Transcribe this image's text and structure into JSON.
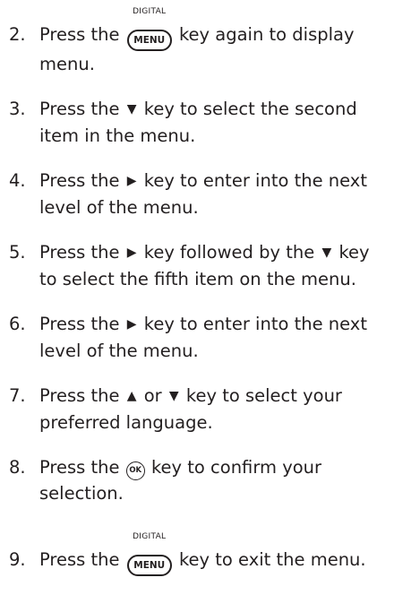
{
  "steps": [
    {
      "number": "2.",
      "before": "Press the",
      "key_caption": "DIGITAL",
      "key_label": "MENU",
      "after": "key again to display menu."
    },
    {
      "number": "3.",
      "text_a": "Press the",
      "glyph_a": "▼",
      "text_b": "key to select the second item in the menu."
    },
    {
      "number": "4.",
      "text_a": "Press the",
      "glyph_a": "▶",
      "text_b": "key to enter into the next level of the menu."
    },
    {
      "number": "5.",
      "text_a": "Press the",
      "glyph_a": "▶",
      "text_b": " key followed by the",
      "glyph_b": "▼",
      "text_c": " key to select the fifth item on the menu."
    },
    {
      "number": "6.",
      "text_a": "Press the",
      "glyph_a": "▶",
      "text_b": "key to enter into the next level of the menu."
    },
    {
      "number": "7.",
      "text_a": "Press the",
      "glyph_a": "▲",
      "text_b": "or",
      "glyph_b": "▼",
      "text_c": "key to select your preferred language."
    },
    {
      "number": "8.",
      "text_a": "Press the",
      "key_label": "OK",
      "text_b": "key to confirm your selection."
    },
    {
      "number": "9.",
      "before": "Press the",
      "key_caption": "DIGITAL",
      "key_label": "MENU",
      "after": "key to exit the menu."
    }
  ]
}
